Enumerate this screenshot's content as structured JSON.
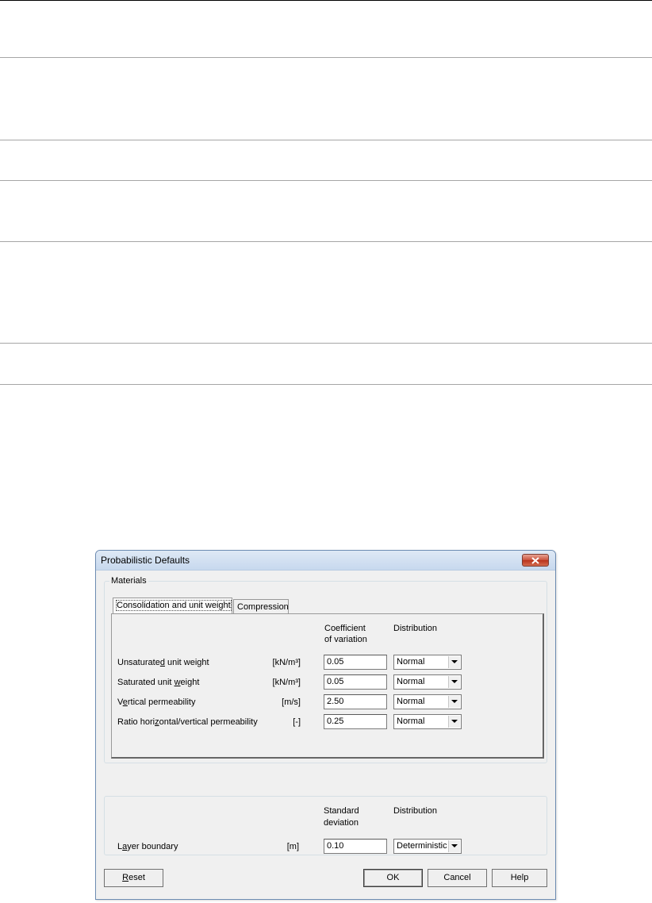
{
  "dialog": {
    "title": "Probabilistic Defaults",
    "materials_group": {
      "label": "Materials",
      "tabs": [
        {
          "label": "Consolidation and unit weight"
        },
        {
          "label": "Compression"
        }
      ],
      "col_coeff_line1": "Coefficient",
      "col_coeff_line2": "of variation",
      "col_distribution": "Distribution",
      "rows": [
        {
          "label_pre": "Unsaturate",
          "label_accel": "d",
          "label_post": " unit weight",
          "unit": "[kN/m³]",
          "value": "0.05",
          "distribution": "Normal"
        },
        {
          "label_pre": "Saturated unit ",
          "label_accel": "w",
          "label_post": "eight",
          "unit": "[kN/m³]",
          "value": "0.05",
          "distribution": "Normal"
        },
        {
          "label_pre": "V",
          "label_accel": "e",
          "label_post": "rtical permeability",
          "unit": "[m/s]",
          "value": "2.50",
          "distribution": "Normal"
        },
        {
          "label_pre": "Ratio hori",
          "label_accel": "z",
          "label_post": "ontal/vertical permeability",
          "unit": "[-]",
          "value": "0.25",
          "distribution": "Normal"
        }
      ]
    },
    "layer_group": {
      "col_std_line1": "Standard",
      "col_std_line2": "deviation",
      "col_distribution": "Distribution",
      "row": {
        "label_pre": "L",
        "label_accel": "a",
        "label_post": "yer boundary",
        "unit": "[m]",
        "value": "0.10",
        "distribution": "Deterministic"
      }
    },
    "buttons": {
      "reset_accel": "R",
      "reset_rest": "eset",
      "ok": "OK",
      "cancel": "Cancel",
      "help": "Help"
    }
  },
  "icons": {
    "close": "close-icon",
    "dropdown": "chevron-down-icon"
  },
  "colors": {
    "close_button": "#c9503a",
    "titlebar": "#c7d8ee"
  }
}
